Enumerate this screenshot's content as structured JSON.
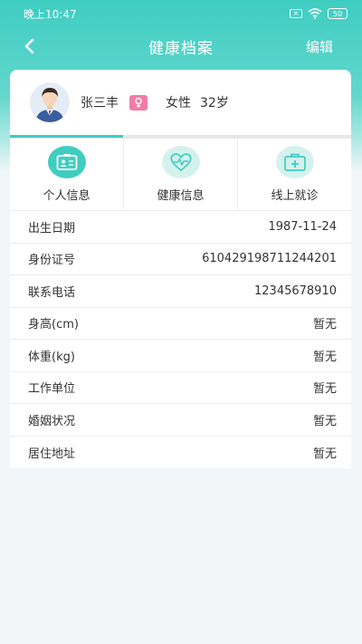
{
  "status_bar": {
    "time": "晚上10:47",
    "battery": "50"
  },
  "nav": {
    "title": "健康档案",
    "edit_label": "编辑"
  },
  "profile": {
    "name": "张三丰",
    "gender": "女性",
    "age": "32岁"
  },
  "tabs": [
    {
      "label": "个人信息",
      "icon": "id-card-icon",
      "active": true
    },
    {
      "label": "健康信息",
      "icon": "heart-pulse-icon",
      "active": false
    },
    {
      "label": "线上就诊",
      "icon": "medical-kit-icon",
      "active": false
    }
  ],
  "info": [
    {
      "label": "出生日期",
      "value": "1987-11-24"
    },
    {
      "label": "身份证号",
      "value": "610429198711244201"
    },
    {
      "label": "联系电话",
      "value": "12345678910"
    },
    {
      "label": "身高(cm)",
      "value": "暂无"
    },
    {
      "label": "体重(kg)",
      "value": "暂无"
    },
    {
      "label": "工作单位",
      "value": "暂无"
    },
    {
      "label": "婚姻状况",
      "value": "暂无"
    },
    {
      "label": "居住地址",
      "value": "暂无"
    }
  ],
  "colors": {
    "accent": "#3fcdc1",
    "accent_light": "#d5f1ee",
    "gender_badge": "#f27ba6"
  }
}
